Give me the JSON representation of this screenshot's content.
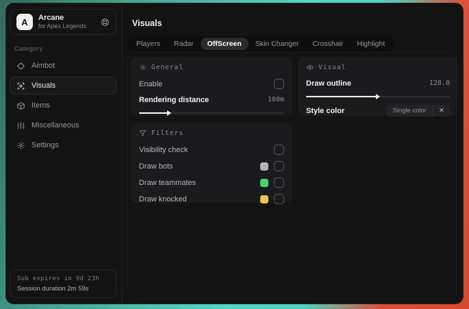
{
  "sidebar": {
    "logo_letter": "A",
    "app_name": "Arcane",
    "app_subtitle": "for Apex Legends",
    "category_label": "Category",
    "items": [
      {
        "label": "Aimbot",
        "icon": "crosshair-icon",
        "selected": false
      },
      {
        "label": "Visuals",
        "icon": "scan-icon",
        "selected": true
      },
      {
        "label": "Items",
        "icon": "cube-icon",
        "selected": false
      },
      {
        "label": "Miscellaneous",
        "icon": "sliders-icon",
        "selected": false
      },
      {
        "label": "Settings",
        "icon": "gear-icon",
        "selected": false
      }
    ],
    "footer": {
      "line1": "Sub expires in 9d 23h",
      "line2": "Session duration 2m 59s"
    }
  },
  "main": {
    "title": "Visuals",
    "tabs": [
      {
        "label": "Players",
        "selected": false
      },
      {
        "label": "Radar",
        "selected": false
      },
      {
        "label": "OffScreen",
        "selected": true
      },
      {
        "label": "Skin Changer",
        "selected": false
      },
      {
        "label": "Crosshair",
        "selected": false
      },
      {
        "label": "Highlight",
        "selected": false
      }
    ],
    "panels": {
      "general": {
        "title": "General",
        "enable_label": "Enable",
        "enable_checked": false,
        "distance_label": "Rendering distance",
        "distance_value": "100m",
        "distance_percent": 20
      },
      "visual": {
        "title": "Visual",
        "outline_label": "Draw outline",
        "outline_value": "128.0",
        "outline_percent": 49,
        "style_label": "Style color",
        "style_tag": "Single color",
        "tag_close_glyph": "✕"
      },
      "filters": {
        "title": "Filters",
        "rows": [
          {
            "label": "Visibility check",
            "swatch": null,
            "checked": false
          },
          {
            "label": "Draw bots",
            "swatch": "#b3b4b6",
            "checked": false
          },
          {
            "label": "Draw teammates",
            "swatch": "#48d56c",
            "checked": false
          },
          {
            "label": "Draw knocked",
            "swatch": "#e6c751",
            "checked": false
          }
        ]
      }
    }
  },
  "colors": {
    "backdrop_teal": "#52d6c4",
    "backdrop_red": "#dd4f3a",
    "panel_bg": "#1b1b1d",
    "accent_white": "#ffffff"
  }
}
